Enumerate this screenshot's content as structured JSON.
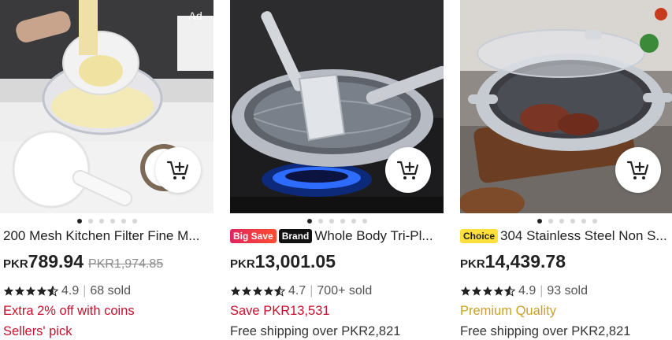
{
  "products": [
    {
      "ad_label": "Ad",
      "title": "200 Mesh Kitchen Filter Fine M...",
      "currency": "PKR",
      "price": "789.94",
      "original_price": "PKR1,974.85",
      "rating": "4.9",
      "sold": "68 sold",
      "promo": "Extra 2% off with coins",
      "extra": "Sellers' pick",
      "promo_color": "#c8102e",
      "extra_color": "#c8102e"
    },
    {
      "tags": [
        "Big Save",
        "Brand"
      ],
      "title": "Whole Body Tri-Pl...",
      "currency": "PKR",
      "price": "13,001.05",
      "rating": "4.7",
      "sold": "700+ sold",
      "promo": "Save PKR13,531",
      "extra": "Free shipping over PKR2,821",
      "promo_color": "#c8102e",
      "extra_color": "#333333"
    },
    {
      "tags": [
        "Choice"
      ],
      "title": "304 Stainless Steel Non S...",
      "currency": "PKR",
      "price": "14,439.78",
      "rating": "4.9",
      "sold": "93 sold",
      "promo": "Premium Quality",
      "extra": "Free shipping over PKR2,821",
      "promo_color": "#c9a227",
      "extra_color": "#333333"
    }
  ],
  "carousel": {
    "dot_count": 6,
    "active_index": 0
  },
  "icons": {
    "cart": "add-to-cart-icon",
    "star": "star-icon"
  }
}
